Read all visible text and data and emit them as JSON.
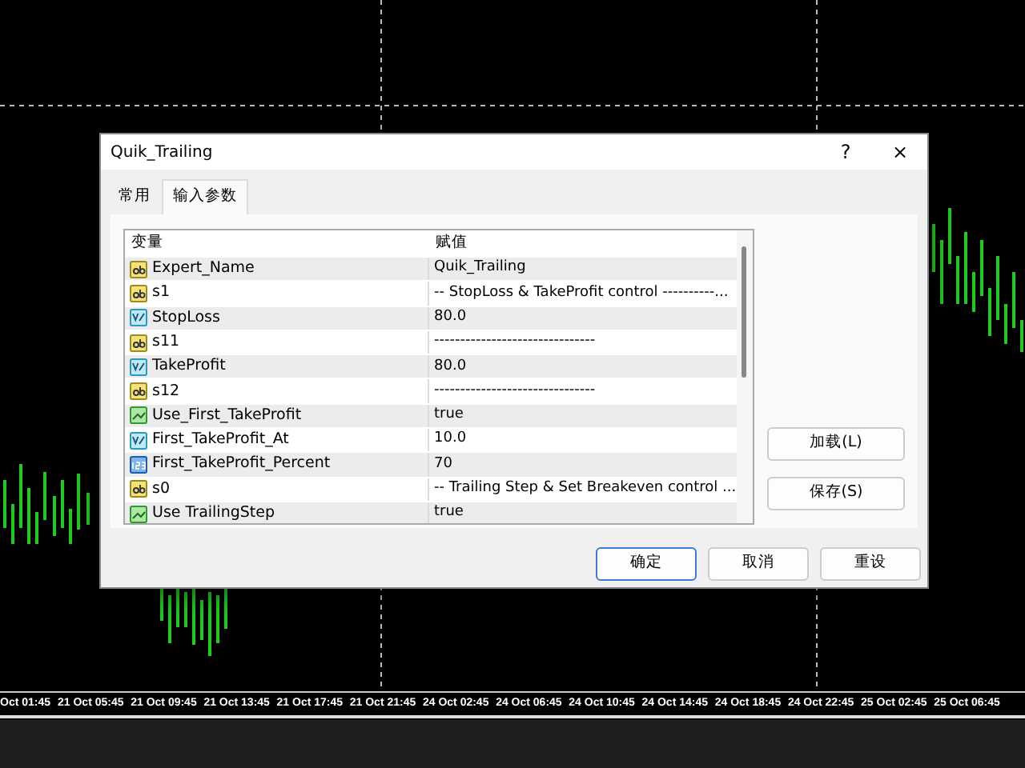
{
  "dialog": {
    "title": "Quik_Trailing",
    "help": "?",
    "close": "×"
  },
  "tabs": [
    {
      "label": "常用",
      "selected": false
    },
    {
      "label": "输入参数",
      "selected": true
    }
  ],
  "table": {
    "columns": [
      "变量",
      "赋值"
    ],
    "rows": [
      {
        "kind": "string",
        "name": "Expert_Name",
        "value": "Quik_Trailing"
      },
      {
        "kind": "string",
        "name": "s1",
        "value": "-- StopLoss & TakeProfit control ----------..."
      },
      {
        "kind": "double",
        "name": "StopLoss",
        "value": "80.0"
      },
      {
        "kind": "string",
        "name": "s11",
        "value": "-------------------------------"
      },
      {
        "kind": "double",
        "name": "TakeProfit",
        "value": "80.0"
      },
      {
        "kind": "string",
        "name": "s12",
        "value": "-------------------------------"
      },
      {
        "kind": "bool",
        "name": "Use_First_TakeProfit",
        "value": "true"
      },
      {
        "kind": "double",
        "name": "First_TakeProfit_At",
        "value": "10.0"
      },
      {
        "kind": "int",
        "name": "First_TakeProfit_Percent",
        "value": "70"
      },
      {
        "kind": "string",
        "name": "s0",
        "value": "-- Trailing Step & Set Breakeven control ..."
      },
      {
        "kind": "bool",
        "name": "Use TrailingStep",
        "value": "true"
      }
    ]
  },
  "side_buttons": [
    "加载(L)",
    "保存(S)"
  ],
  "buttons": [
    {
      "label": "确定",
      "default": true
    },
    {
      "label": "取消",
      "default": false
    },
    {
      "label": "重设",
      "default": false
    }
  ],
  "time_axis": [
    "Oct 01:45",
    "21 Oct 05:45",
    "21 Oct 09:45",
    "21 Oct 13:45",
    "21 Oct 17:45",
    "21 Oct 21:45",
    "24 Oct 02:45",
    "24 Oct 06:45",
    "24 Oct 10:45",
    "24 Oct 14:45",
    "24 Oct 18:45",
    "24 Oct 22:45",
    "25 Oct 02:45",
    "25 Oct 06:45"
  ]
}
